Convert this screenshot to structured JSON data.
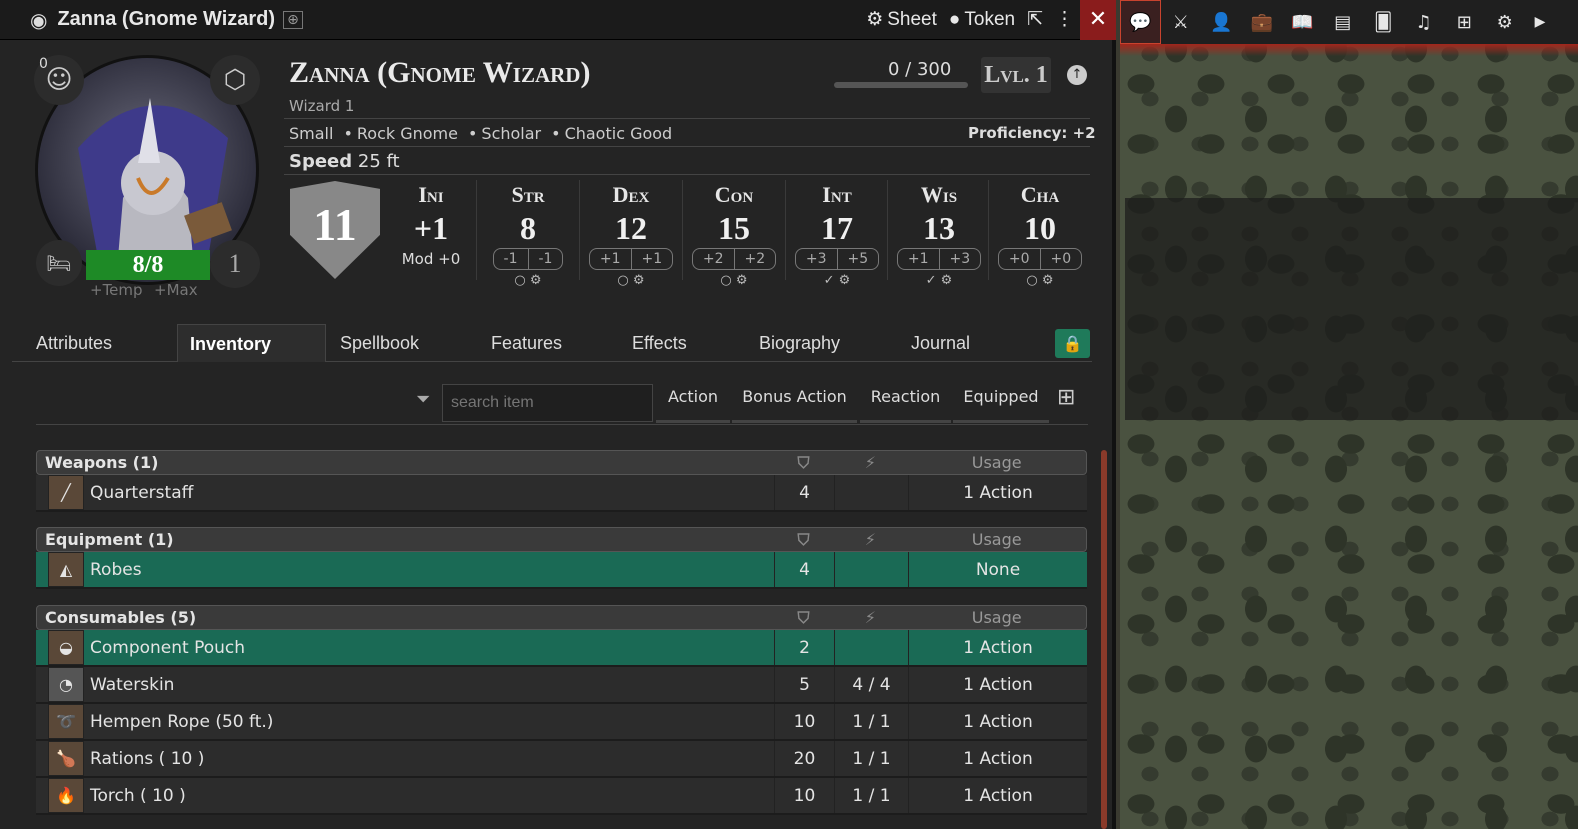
{
  "window": {
    "title": "Zanna (Gnome Wizard)",
    "sheet_label": "Sheet",
    "token_label": "Token",
    "close": "✕"
  },
  "portrait": {
    "inspiration": "0",
    "hp": "8/8",
    "temp_label": "+Temp",
    "max_label": "+Max",
    "hit_dice": "1"
  },
  "character": {
    "name": "Zanna (Gnome Wizard)",
    "class_line": "Wizard 1",
    "size": "Small",
    "race": "Rock Gnome",
    "background": "Scholar",
    "alignment": "Chaotic Good",
    "proficiency": "Proficiency: +2",
    "speed_label": "Speed",
    "speed_value": "25 ft",
    "xp": "0 / 300",
    "level": "Lvl. 1",
    "ac": "11"
  },
  "initiative": {
    "label": "Ini",
    "value": "+1",
    "mod": "Mod +0"
  },
  "abilities": [
    {
      "label": "Str",
      "score": "8",
      "mod": "-1",
      "save": "-1"
    },
    {
      "label": "Dex",
      "score": "12",
      "mod": "+1",
      "save": "+1"
    },
    {
      "label": "Con",
      "score": "15",
      "mod": "+2",
      "save": "+2"
    },
    {
      "label": "Int",
      "score": "17",
      "mod": "+3",
      "save": "+5"
    },
    {
      "label": "Wis",
      "score": "13",
      "mod": "+1",
      "save": "+3"
    },
    {
      "label": "Cha",
      "score": "10",
      "mod": "+0",
      "save": "+0"
    }
  ],
  "tabs": [
    "Attributes",
    "Inventory",
    "Spellbook",
    "Features",
    "Effects",
    "Biography",
    "Journal"
  ],
  "filter": {
    "placeholder": "search item",
    "action": "Action",
    "bonus": "Bonus Action",
    "reaction": "Reaction",
    "equipped": "Equipped"
  },
  "usage_label": "Usage",
  "sections": [
    {
      "title": "Weapons (1)",
      "items": [
        {
          "name": "Quarterstaff",
          "weight": "4",
          "uses": "",
          "usage": "1 Action",
          "equipped": false
        }
      ]
    },
    {
      "title": "Equipment (1)",
      "items": [
        {
          "name": "Robes",
          "weight": "4",
          "uses": "",
          "usage": "None",
          "equipped": true
        }
      ]
    },
    {
      "title": "Consumables (5)",
      "items": [
        {
          "name": "Component Pouch",
          "weight": "2",
          "uses": "",
          "usage": "1 Action",
          "equipped": true
        },
        {
          "name": "Waterskin",
          "weight": "5",
          "uses": "4 / 4",
          "usage": "1 Action",
          "equipped": false
        },
        {
          "name": "Hempen Rope (50 ft.)",
          "weight": "10",
          "uses": "1 / 1",
          "usage": "1 Action",
          "equipped": false
        },
        {
          "name": "Rations ( 10 )",
          "weight": "20",
          "uses": "1 / 1",
          "usage": "1 Action",
          "equipped": false
        },
        {
          "name": "Torch ( 10 )",
          "weight": "10",
          "uses": "1 / 1",
          "usage": "1 Action",
          "equipped": false
        }
      ]
    }
  ],
  "xp_progress": 0,
  "colors": {
    "equipped": "#1a6a55",
    "hp": "#1e8a26",
    "close": "#8a1c1c",
    "lock": "#1f7a5a"
  }
}
